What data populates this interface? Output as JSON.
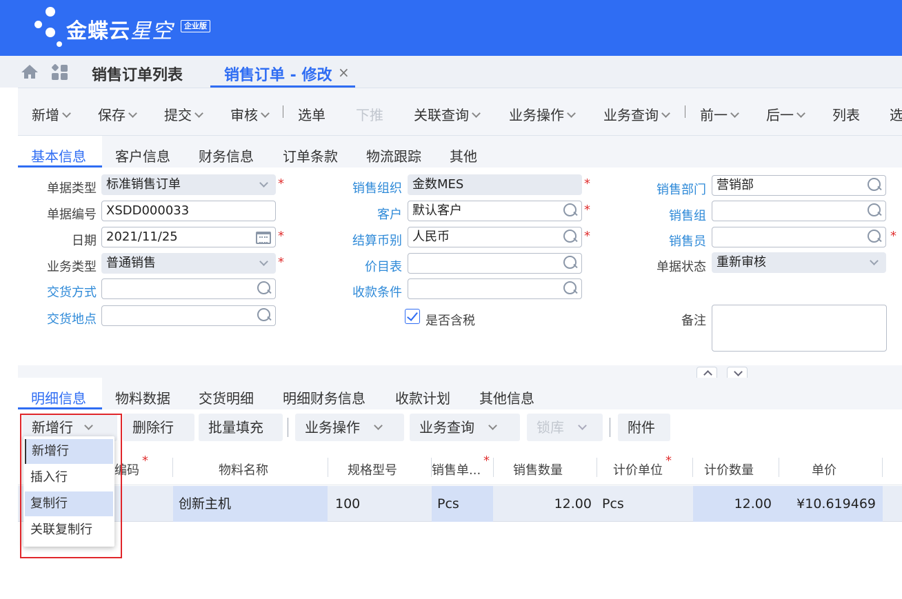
{
  "brand": {
    "name": "金蝶云",
    "name_light": "星空",
    "badge": "企业版"
  },
  "tabs": {
    "list": "销售订单列表",
    "active": "销售订单 - 修改",
    "close": "×"
  },
  "toolbar": {
    "new": "新增",
    "save": "保存",
    "submit": "提交",
    "audit": "审核",
    "select": "选单",
    "push": "下推",
    "related": "关联查询",
    "biz_op": "业务操作",
    "biz_query": "业务查询",
    "prev": "前一",
    "next": "后一",
    "list": "列表",
    "more": "选"
  },
  "head_tabs": [
    "基本信息",
    "客户信息",
    "财务信息",
    "订单条款",
    "物流跟踪",
    "其他"
  ],
  "form": {
    "bill_type": {
      "label": "单据类型",
      "value": "标准销售订单"
    },
    "bill_no": {
      "label": "单据编号",
      "value": "XSDD000033"
    },
    "date": {
      "label": "日期",
      "value": "2021/11/25"
    },
    "biz_type": {
      "label": "业务类型",
      "value": "普通销售"
    },
    "delivery_method": {
      "label": "交货方式",
      "value": ""
    },
    "delivery_place": {
      "label": "交货地点",
      "value": ""
    },
    "sale_org": {
      "label": "销售组织",
      "value": "金数MES"
    },
    "customer": {
      "label": "客户",
      "value": "默认客户"
    },
    "currency": {
      "label": "结算币别",
      "value": "人民币"
    },
    "price_list": {
      "label": "价目表",
      "value": ""
    },
    "payment_terms": {
      "label": "收款条件",
      "value": ""
    },
    "tax_included": {
      "label": "是否含税",
      "checked": true
    },
    "sale_dept": {
      "label": "销售部门",
      "value": "营销部"
    },
    "sale_group": {
      "label": "销售组",
      "value": ""
    },
    "salesman": {
      "label": "销售员",
      "value": ""
    },
    "bill_status": {
      "label": "单据状态",
      "value": "重新审核"
    },
    "remark": {
      "label": "备注",
      "value": ""
    },
    "required_mark": "*"
  },
  "detail_tabs": [
    "明细信息",
    "物料数据",
    "交货明细",
    "明细财务信息",
    "收款计划",
    "其他信息"
  ],
  "detail_toolbar": {
    "add_row": "新增行",
    "delete_row": "删除行",
    "batch_fill": "批量填充",
    "biz_op": "业务操作",
    "biz_query": "业务查询",
    "lock": "锁库",
    "attach": "附件"
  },
  "grid": {
    "columns": [
      "编码",
      "物料名称",
      "规格型号",
      "销售单...",
      "销售数量",
      "计价单位",
      "计价数量",
      "单价"
    ],
    "rows": [
      {
        "name": "创新主机",
        "spec": "100",
        "unit": "Pcs",
        "qty": "12.00",
        "price_unit": "Pcs",
        "price_qty": "12.00",
        "price": "¥10.619469"
      }
    ]
  },
  "add_row_menu": [
    "新增行",
    "插入行",
    "复制行",
    "关联复制行"
  ]
}
